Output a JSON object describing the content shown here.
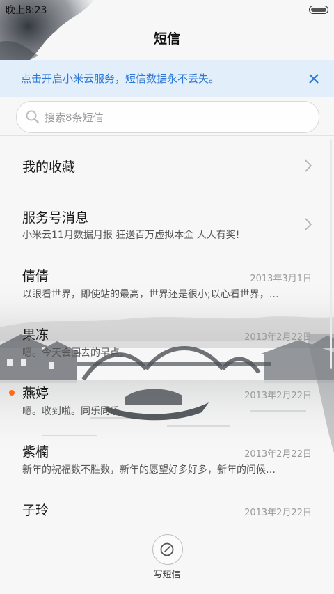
{
  "status_bar": {
    "time": "晚上8:23"
  },
  "header": {
    "title": "短信"
  },
  "banner": {
    "text": "点击开启小米云服务，短信数据永不丢失。"
  },
  "search": {
    "placeholder": "搜索8条短信"
  },
  "conversations": [
    {
      "name": "我的收藏",
      "preview": "",
      "date": "",
      "chevron": true
    },
    {
      "name": "服务号消息",
      "preview": "小米云11月数据月报 狂送百万虚拟本金 人人有奖!",
      "date": "",
      "chevron": true
    },
    {
      "name": "倩倩",
      "preview": "以眼看世界，即使站的最高，世界还是很小;以心看世界，…",
      "date": "2013年3月1日"
    },
    {
      "name": "果冻",
      "preview": "嗯。今天会回去的早点。",
      "date": "2013年2月22日"
    },
    {
      "name": "燕婷",
      "preview": "嗯。收到啦。同乐同乐。",
      "date": "2013年2月22日",
      "unread": true
    },
    {
      "name": "紫楠",
      "preview": "新年的祝福数不胜数，新年的愿望好多好多，新年的问候…",
      "date": "2013年2月22日"
    },
    {
      "name": "子玲",
      "preview": "",
      "date": "2013年2月22日"
    }
  ],
  "compose": {
    "label": "写短信"
  },
  "colors": {
    "accent": "#2b78d6",
    "banner_bg": "#e3eefb",
    "unread_dot": "#ff6a1a"
  },
  "icons": {
    "search": "search-icon",
    "close": "close-icon",
    "chevron": "chevron-right-icon",
    "compose": "compose-icon"
  }
}
